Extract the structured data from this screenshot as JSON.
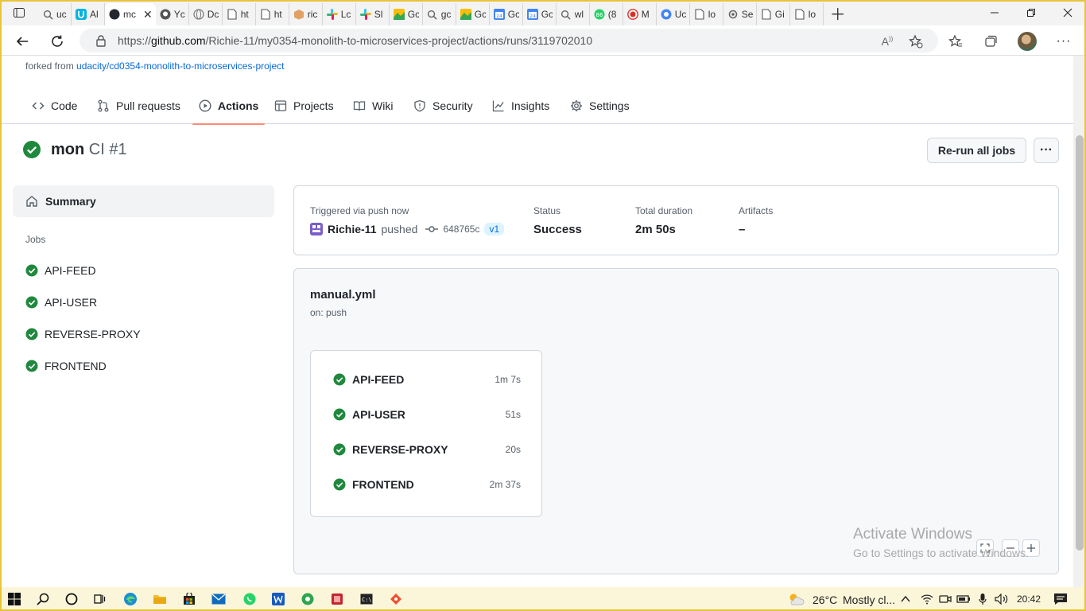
{
  "browser": {
    "tabs": [
      {
        "icon": "search-icon",
        "label": "uc"
      },
      {
        "icon": "udacity-icon",
        "label": "Al"
      },
      {
        "icon": "github-page-icon",
        "label": "mc",
        "active": true
      },
      {
        "icon": "github-icon",
        "label": "Yc"
      },
      {
        "icon": "globe-icon",
        "label": "Dc"
      },
      {
        "icon": "page-icon",
        "label": "ht"
      },
      {
        "icon": "page-icon",
        "label": "ht"
      },
      {
        "icon": "box-icon",
        "label": "ric"
      },
      {
        "icon": "slack-icon",
        "label": "Lc"
      },
      {
        "icon": "slack-icon",
        "label": "Sl"
      },
      {
        "icon": "photos-icon",
        "label": "Gc"
      },
      {
        "icon": "search-icon",
        "label": "gc"
      },
      {
        "icon": "photos-icon",
        "label": "Gc"
      },
      {
        "icon": "calendar-icon",
        "label": "Gc"
      },
      {
        "icon": "calendar-icon",
        "label": "Gc"
      },
      {
        "icon": "search-icon",
        "label": "wl"
      },
      {
        "icon": "whatsapp-icon",
        "label": "(8"
      },
      {
        "icon": "record-icon",
        "label": "M"
      },
      {
        "icon": "chrome-icon",
        "label": "Uc"
      },
      {
        "icon": "page-icon",
        "label": "lo"
      },
      {
        "icon": "gear-icon",
        "label": "Se"
      },
      {
        "icon": "page-icon",
        "label": "Gi"
      },
      {
        "icon": "page-icon",
        "label": "lo"
      }
    ],
    "url": {
      "scheme": "https://",
      "host": "github.com",
      "path": "/Richie-11/my0354-monolith-to-microservices-project/actions/runs/3119702010"
    }
  },
  "repo": {
    "forked_prefix": "forked from",
    "forked_link": "udacity/cd0354-monolith-to-microservices-project",
    "nav": [
      {
        "id": "code",
        "label": "Code",
        "icon": "code-icon"
      },
      {
        "id": "pull-requests",
        "label": "Pull requests",
        "icon": "pull-request-icon"
      },
      {
        "id": "actions",
        "label": "Actions",
        "icon": "play-icon",
        "active": true
      },
      {
        "id": "projects",
        "label": "Projects",
        "icon": "table-icon"
      },
      {
        "id": "wiki",
        "label": "Wiki",
        "icon": "book-icon"
      },
      {
        "id": "security",
        "label": "Security",
        "icon": "shield-icon"
      },
      {
        "id": "insights",
        "label": "Insights",
        "icon": "graph-icon"
      },
      {
        "id": "settings",
        "label": "Settings",
        "icon": "gear-icon"
      }
    ]
  },
  "run": {
    "name": "mon",
    "workflow_number": "CI #1",
    "rerun_label": "Re-run all jobs",
    "more_label": "···"
  },
  "sidebar": {
    "summary_label": "Summary",
    "jobs_heading": "Jobs",
    "jobs": [
      "API-FEED",
      "API-USER",
      "REVERSE-PROXY",
      "FRONTEND"
    ]
  },
  "summary": {
    "triggered": "Triggered via push now",
    "actor": "Richie-11",
    "action": "pushed",
    "commit": "648765c",
    "branch": "v1",
    "status_label": "Status",
    "status_value": "Success",
    "duration_label": "Total duration",
    "duration_value": "2m 50s",
    "artifacts_label": "Artifacts",
    "artifacts_value": "–"
  },
  "workflow": {
    "file": "manual.yml",
    "trigger": "on: push",
    "jobs": [
      {
        "name": "API-FEED",
        "duration": "1m 7s"
      },
      {
        "name": "API-USER",
        "duration": "51s"
      },
      {
        "name": "REVERSE-PROXY",
        "duration": "20s"
      },
      {
        "name": "FRONTEND",
        "duration": "2m 37s"
      }
    ]
  },
  "watermark": {
    "line1": "Activate Windows",
    "line2": "Go to Settings to activate Windows."
  },
  "taskbar": {
    "weather": "26°C",
    "weather_desc": "Mostly cl...",
    "time": "20:42"
  },
  "colors": {
    "success": "#1f883d",
    "link": "#0969da",
    "active_underline": "#fd8c73"
  }
}
